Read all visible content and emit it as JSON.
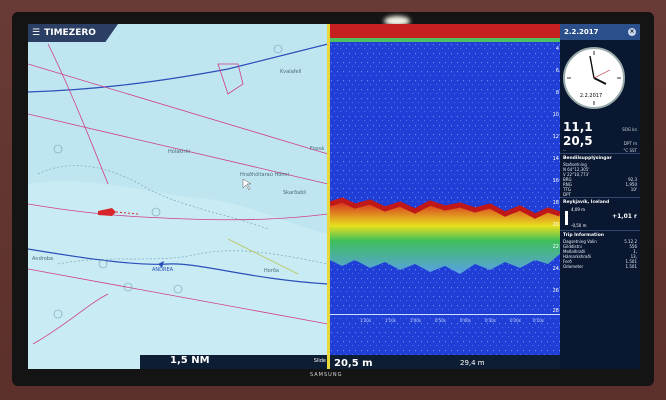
{
  "app": {
    "brand": "TIMEZERO",
    "menu_icon": "hamburger-icon"
  },
  "chart": {
    "places": {
      "p1": "Kvalafell",
      "p2": "Hólakirki",
      "p3": "Fossá",
      "p4": "Hraðhóltaraú Hólmi",
      "p5": "Skarðabli",
      "p6": "Androba",
      "p7": "Horða"
    },
    "vessel_label": "ANDREA",
    "range_label": "Slide",
    "range_value": "1,5 NM"
  },
  "sonar": {
    "depth_ticks": [
      "4",
      "6",
      "8",
      "10",
      "12",
      "14",
      "16",
      "18",
      "20",
      "22",
      "24",
      "26",
      "28"
    ],
    "time_ticks": [
      "1'20s",
      "1'10s",
      "1'00s",
      "0'50s",
      "0'40s",
      "0'30s",
      "0'20s",
      "0'10s"
    ],
    "depth_readout": "20,5 m",
    "distance_readout": "29,4 m"
  },
  "panel": {
    "date": "2.2.2017",
    "clock_date": "2.2.2017",
    "sog": {
      "value": "11,1",
      "unit": "kn",
      "label": "SOG"
    },
    "dpt": {
      "value": "20,5",
      "unit": "m",
      "label": "DPT"
    },
    "sst": {
      "value": "--",
      "unit": "°C",
      "label": "SST"
    },
    "position_title": "Bendilsupplýsingar",
    "position_sub": "Staðsetning",
    "lat": "N 64°12,305'",
    "lon": "V 22°10,773'",
    "brg": {
      "label": "BRG",
      "value": "92,3"
    },
    "rng": {
      "label": "RNG",
      "value": "1,950"
    },
    "ttg": {
      "label": "TTG",
      "value": "10'"
    },
    "dpt2": {
      "label": "DPT",
      "value": ""
    },
    "tide_title": "Reykjavík, Iceland",
    "tide_top": "4,09 m",
    "tide_bottom": "-0,50 m",
    "tide_value": "+1,01 r",
    "trip_title": "Trip Information",
    "trip": [
      {
        "label": "Dagsetning Valin",
        "value": "5.12.2"
      },
      {
        "label": "Gilddistni",
        "value": "556"
      },
      {
        "label": "Meðalhraði",
        "value": "1,"
      },
      {
        "label": "Hámarkshraði",
        "value": "13,"
      },
      {
        "label": "Ferð",
        "value": "1.501"
      },
      {
        "label": "Odometer",
        "value": "1.501"
      }
    ]
  },
  "tv_brand": "SAMSUNG",
  "colors": {
    "sea": "#bfe6f0",
    "sonar_bg": "#1f3fd6",
    "panel": "#0a1730",
    "divider": "#e8d83a",
    "vessel": "#d7262b"
  }
}
